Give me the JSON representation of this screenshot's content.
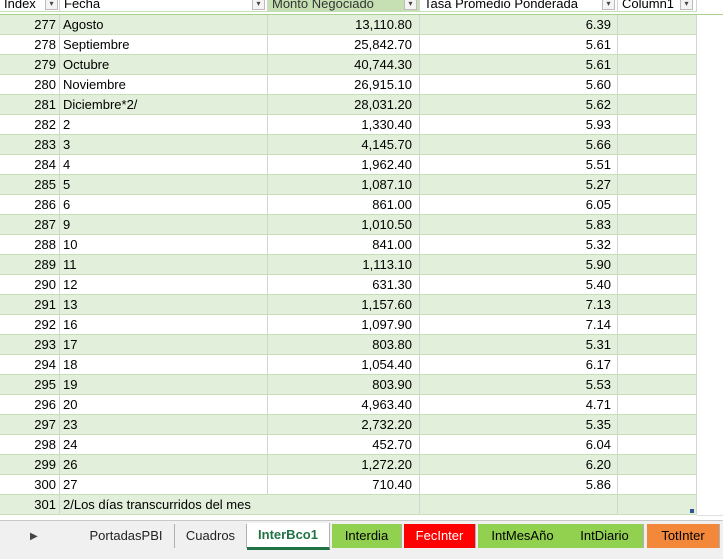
{
  "headers": {
    "index": "Index",
    "fecha": "Fecha",
    "monto": "Monto Negociado",
    "tasa": "Tasa Promedio Ponderada",
    "column1": "Column1"
  },
  "header_icons": {
    "index": "sort-filter-icon",
    "other": "dropdown-arrow-icon"
  },
  "rows": [
    {
      "index": "277",
      "fecha": "Agosto",
      "monto": "13,110.80",
      "tasa": "6.39"
    },
    {
      "index": "278",
      "fecha": "Septiembre",
      "monto": "25,842.70",
      "tasa": "5.61"
    },
    {
      "index": "279",
      "fecha": "Octubre",
      "monto": "40,744.30",
      "tasa": "5.61"
    },
    {
      "index": "280",
      "fecha": "Noviembre",
      "monto": "26,915.10",
      "tasa": "5.60"
    },
    {
      "index": "281",
      "fecha": "Diciembre*2/",
      "monto": "28,031.20",
      "tasa": "5.62"
    },
    {
      "index": "282",
      "fecha": "2",
      "monto": "1,330.40",
      "tasa": "5.93"
    },
    {
      "index": "283",
      "fecha": "3",
      "monto": "4,145.70",
      "tasa": "5.66"
    },
    {
      "index": "284",
      "fecha": "4",
      "monto": "1,962.40",
      "tasa": "5.51"
    },
    {
      "index": "285",
      "fecha": "5",
      "monto": "1,087.10",
      "tasa": "5.27"
    },
    {
      "index": "286",
      "fecha": "6",
      "monto": "861.00",
      "tasa": "6.05"
    },
    {
      "index": "287",
      "fecha": "9",
      "monto": "1,010.50",
      "tasa": "5.83"
    },
    {
      "index": "288",
      "fecha": "10",
      "monto": "841.00",
      "tasa": "5.32"
    },
    {
      "index": "289",
      "fecha": "11",
      "monto": "1,113.10",
      "tasa": "5.90"
    },
    {
      "index": "290",
      "fecha": "12",
      "monto": "631.30",
      "tasa": "5.40"
    },
    {
      "index": "291",
      "fecha": "13",
      "monto": "1,157.60",
      "tasa": "7.13"
    },
    {
      "index": "292",
      "fecha": "16",
      "monto": "1,097.90",
      "tasa": "7.14"
    },
    {
      "index": "293",
      "fecha": "17",
      "monto": "803.80",
      "tasa": "5.31"
    },
    {
      "index": "294",
      "fecha": "18",
      "monto": "1,054.40",
      "tasa": "6.17"
    },
    {
      "index": "295",
      "fecha": "19",
      "monto": "803.90",
      "tasa": "5.53"
    },
    {
      "index": "296",
      "fecha": "20",
      "monto": "4,963.40",
      "tasa": "4.71"
    },
    {
      "index": "297",
      "fecha": "23",
      "monto": "2,732.20",
      "tasa": "5.35"
    },
    {
      "index": "298",
      "fecha": "24",
      "monto": "452.70",
      "tasa": "6.04"
    },
    {
      "index": "299",
      "fecha": "26",
      "monto": "1,272.20",
      "tasa": "6.20"
    },
    {
      "index": "300",
      "fecha": "27",
      "monto": "710.40",
      "tasa": "5.86"
    },
    {
      "index": "301",
      "fecha": "2/Los días transcurridos del mes",
      "monto": "",
      "tasa": ""
    }
  ],
  "sheet_tabs": [
    {
      "label": "PortadasPBI",
      "color": "#f0f0f0",
      "text_color": "#222222",
      "active": false
    },
    {
      "label": "Cuadros",
      "color": "#f0f0f0",
      "text_color": "#222222",
      "active": false
    },
    {
      "label": "InterBco1",
      "color": "#ffffff",
      "text_color": "#217346",
      "active": true
    },
    {
      "label": "Interdia",
      "color": "#92d050",
      "text_color": "#000000",
      "active": false
    },
    {
      "label": "FecInter",
      "color": "#ff0000",
      "text_color": "#ffffff",
      "active": false
    },
    {
      "label": "IntMesAño",
      "color": "#92d050",
      "text_color": "#000000",
      "active": false
    },
    {
      "label": "IntDiario",
      "color": "#92d050",
      "text_color": "#000000",
      "active": false
    },
    {
      "label": "TotInter",
      "color": "#f4883a",
      "text_color": "#000000",
      "active": false
    }
  ],
  "nav_icon": "scroll-right-icon",
  "colors": {
    "band": "#e2efda",
    "header_selected": "#c6e0b4",
    "accent": "#217346"
  }
}
